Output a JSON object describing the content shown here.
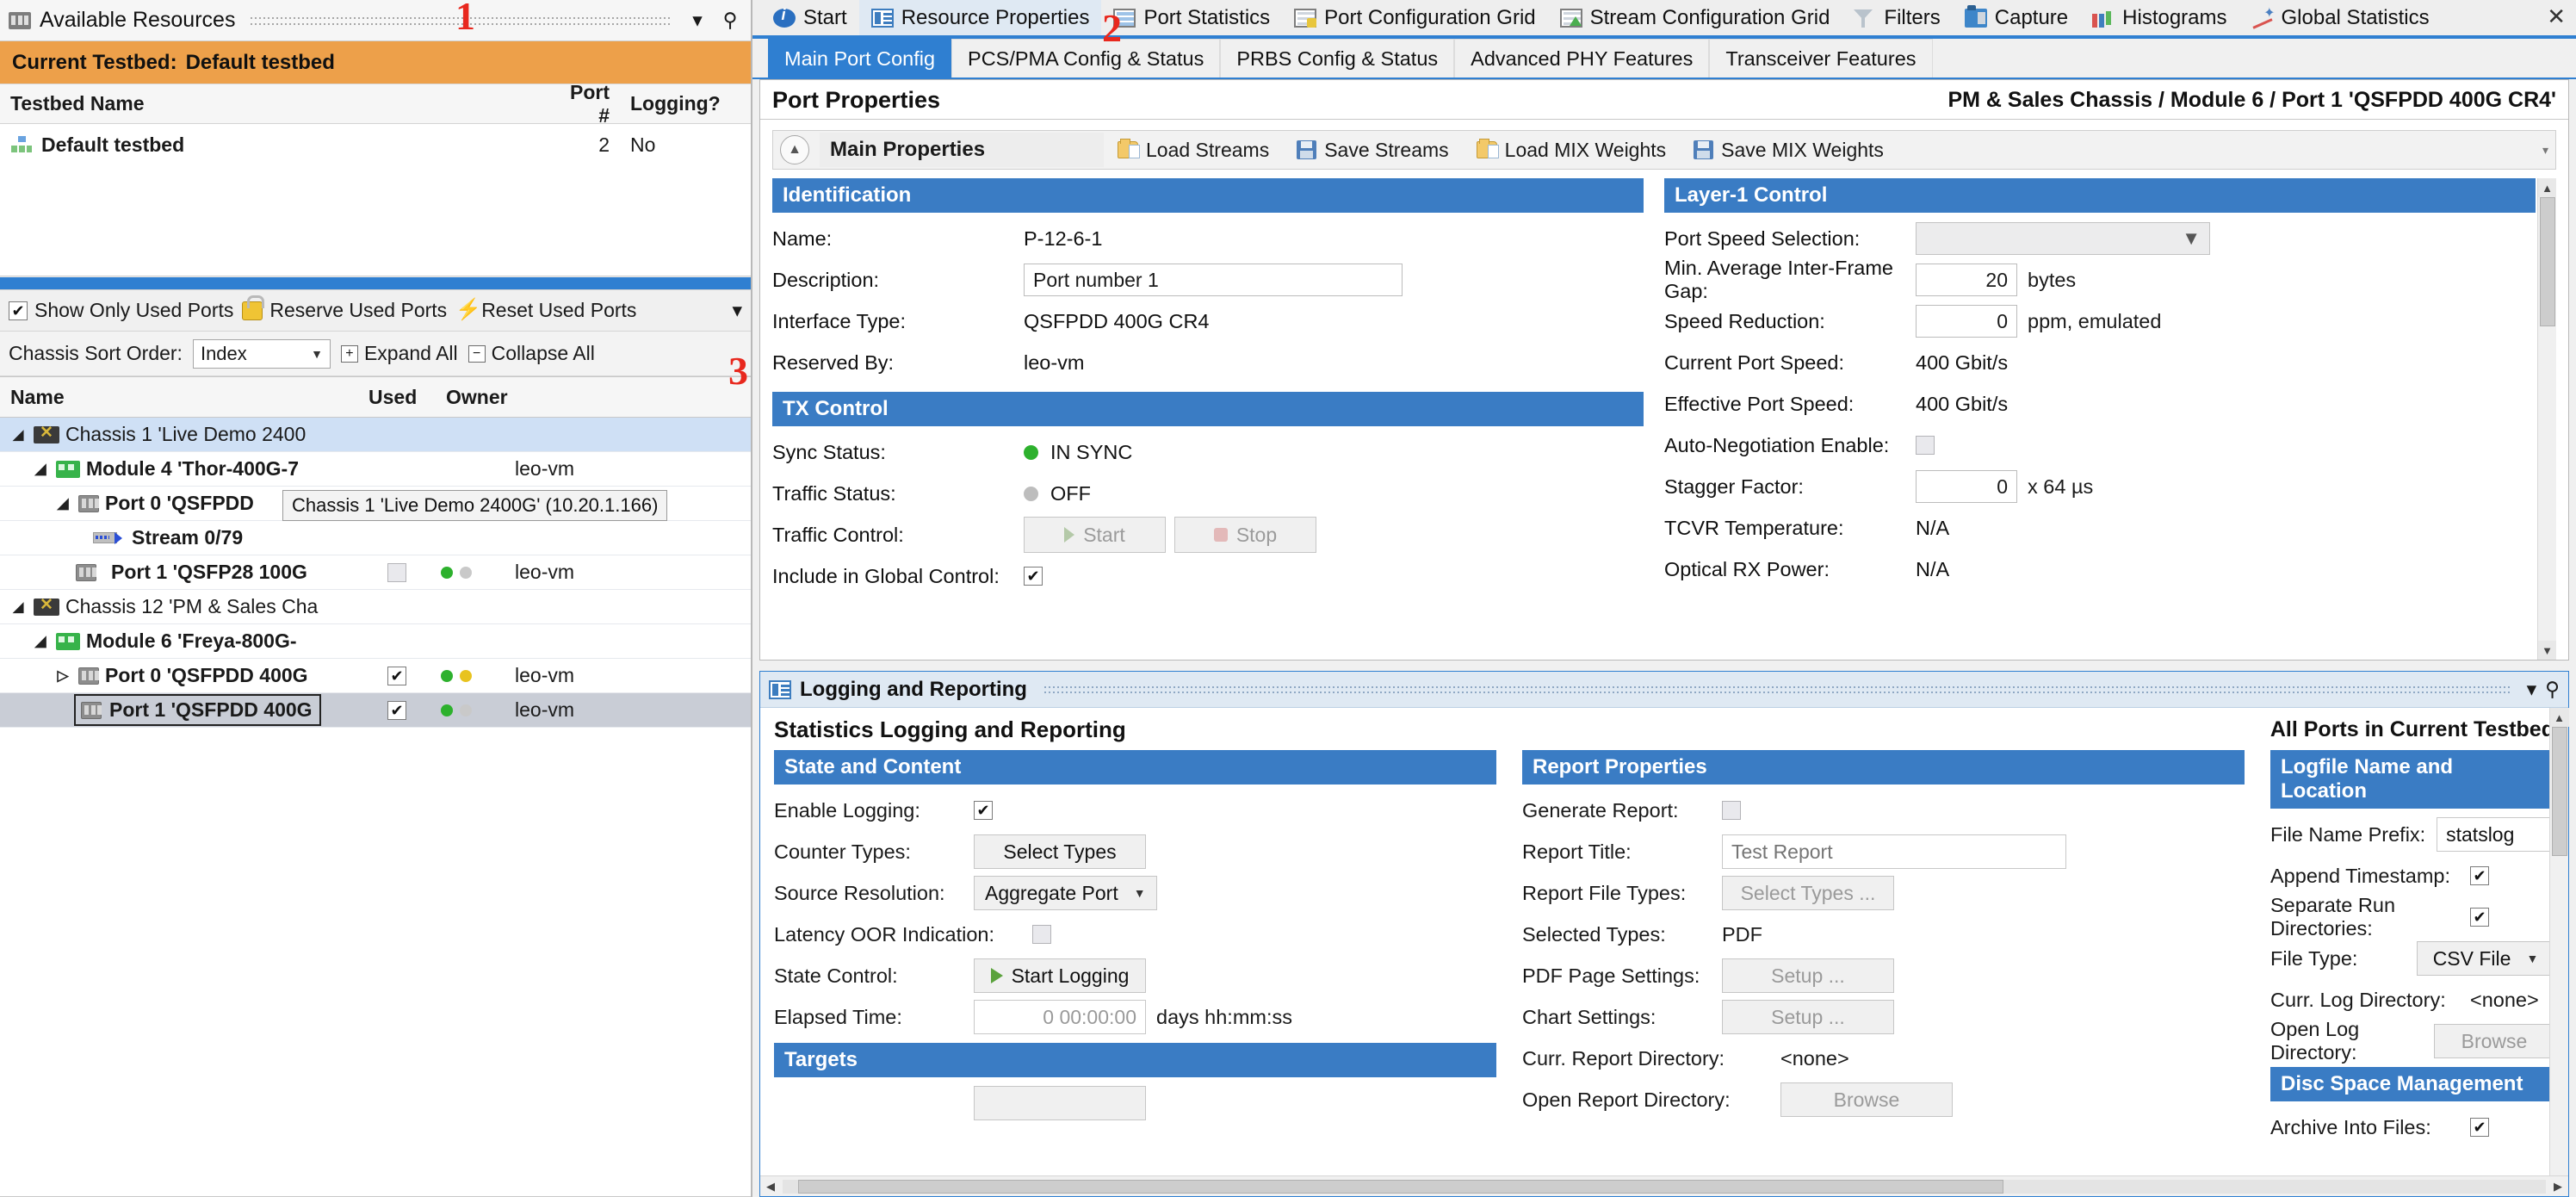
{
  "left_panel": {
    "title": "Available Resources",
    "title_icon": "resources-icon",
    "collapse_icon": "chevron-down-icon",
    "pin_icon": "pin-icon",
    "testbed_banner": {
      "label": "Current Testbed:",
      "value": "Default testbed"
    },
    "testbed_table": {
      "columns": [
        "Testbed Name",
        "Port #",
        "Logging?"
      ],
      "rows": [
        {
          "name": "Default testbed",
          "port_count": "2",
          "logging": "No"
        }
      ]
    },
    "toolbar": {
      "show_only_used_ports": {
        "label": "Show Only Used Ports",
        "checked": true
      },
      "reserve_used_ports": "Reserve Used Ports",
      "reset_used_ports": "Reset Used Ports",
      "overflow_icon": "chevron-down-icon"
    },
    "sort_row": {
      "label": "Chassis Sort Order:",
      "selected": "Index",
      "expand_all": "Expand All",
      "collapse_all": "Collapse All"
    },
    "tree": {
      "columns": [
        "Name",
        "Used",
        "Owner"
      ],
      "tooltip": "Chassis 1 'Live Demo 2400G' (10.20.1.166)",
      "rows": [
        {
          "indent": 0,
          "expander": "down",
          "icon": "chassis-icon",
          "label": "Chassis 1 'Live Demo 2400",
          "bold": false,
          "selected": "light",
          "used": "",
          "owner": "",
          "leds": []
        },
        {
          "indent": 1,
          "expander": "down",
          "icon": "module-icon",
          "label": "Module 4 'Thor-400G-7",
          "bold": true,
          "used": "",
          "owner": "leo-vm",
          "leds": []
        },
        {
          "indent": 2,
          "expander": "down",
          "icon": "port-icon",
          "label": "Port 0 'QSFPDD",
          "bold": true,
          "used": "",
          "owner": "",
          "leds": []
        },
        {
          "indent": 3,
          "expander": "none",
          "icon": "stream-icon",
          "label": "Stream 0/79",
          "bold": true,
          "used": "",
          "owner": "",
          "leds": []
        },
        {
          "indent": 3,
          "expander": "none",
          "icon": "port-icon",
          "label": "Port 1 'QSFP28 100G",
          "bold": true,
          "used": "unchecked",
          "owner": "leo-vm",
          "leds": [
            "green",
            "gray"
          ]
        },
        {
          "indent": 0,
          "expander": "down",
          "icon": "chassis-icon",
          "label": "Chassis 12 'PM & Sales Cha",
          "bold": false,
          "used": "",
          "owner": "",
          "leds": []
        },
        {
          "indent": 1,
          "expander": "down",
          "icon": "module-icon",
          "label": "Module 6 'Freya-800G-",
          "bold": true,
          "used": "",
          "owner": "",
          "leds": []
        },
        {
          "indent": 2,
          "expander": "right",
          "icon": "port-icon",
          "label": "Port 0 'QSFPDD 400G",
          "bold": true,
          "used": "checked",
          "owner": "leo-vm",
          "leds": [
            "green",
            "yellow"
          ]
        },
        {
          "indent": 3,
          "expander": "none",
          "icon": "port-icon",
          "label": "Port 1 'QSFPDD 400G",
          "bold": true,
          "selected": "gray",
          "used": "checked",
          "owner": "leo-vm",
          "leds": [
            "green",
            "gray"
          ]
        }
      ]
    }
  },
  "doc_tabs": [
    {
      "label": "Start",
      "icon": "info-icon",
      "active": false
    },
    {
      "label": "Resource Properties",
      "icon": "resource-properties-icon",
      "active": true
    },
    {
      "label": "Port Statistics",
      "icon": "port-statistics-icon",
      "active": false
    },
    {
      "label": "Port Configuration Grid",
      "icon": "port-configuration-grid-icon",
      "active": false
    },
    {
      "label": "Stream Configuration Grid",
      "icon": "stream-configuration-grid-icon",
      "active": false
    },
    {
      "label": "Filters",
      "icon": "filter-icon",
      "active": false
    },
    {
      "label": "Capture",
      "icon": "capture-icon",
      "active": false
    },
    {
      "label": "Histograms",
      "icon": "histogram-icon",
      "active": false
    },
    {
      "label": "Global Statistics",
      "icon": "global-statistics-icon",
      "active": false
    }
  ],
  "doc_tabs_right": {
    "close_icon": "close-icon",
    "list_icon": "tab-list-icon"
  },
  "inner_tabs": [
    {
      "label": "Main Port Config",
      "active": true
    },
    {
      "label": "PCS/PMA Config & Status",
      "active": false
    },
    {
      "label": "PRBS Config & Status",
      "active": false
    },
    {
      "label": "Advanced PHY Features",
      "active": false
    },
    {
      "label": "Transceiver Features",
      "active": false
    }
  ],
  "port_properties": {
    "title": "Port Properties",
    "breadcrumb": "PM & Sales Chassis / Module 6 / Port 1 'QSFPDD 400G CR4'",
    "group_title": "Main Properties",
    "collapse_icon": "chevron-up-icon",
    "toolbar_buttons": [
      {
        "label": "Load Streams",
        "icon": "folder-open-icon"
      },
      {
        "label": "Save Streams",
        "icon": "save-icon"
      },
      {
        "label": "Load MIX Weights",
        "icon": "folder-open-icon"
      },
      {
        "label": "Save MIX Weights",
        "icon": "save-icon"
      }
    ],
    "identification": {
      "header": "Identification",
      "rows": [
        {
          "label": "Name:",
          "value": "P-12-6-1",
          "type": "text"
        },
        {
          "label": "Description:",
          "value": "Port number 1",
          "type": "input"
        },
        {
          "label": "Interface Type:",
          "value": "QSFPDD 400G CR4",
          "type": "text"
        },
        {
          "label": "Reserved By:",
          "value": "leo-vm",
          "type": "text"
        }
      ]
    },
    "tx_control": {
      "header": "TX Control",
      "sync_status": {
        "label": "Sync Status:",
        "value": "IN SYNC",
        "led": "green"
      },
      "traffic_status": {
        "label": "Traffic Status:",
        "value": "OFF",
        "led": "gray"
      },
      "traffic_control": {
        "label": "Traffic Control:",
        "start": "Start",
        "stop": "Stop"
      },
      "include_global": {
        "label": "Include in Global Control:",
        "checked": true
      }
    },
    "layer1_control": {
      "header": "Layer-1 Control",
      "rows": [
        {
          "label": "Port Speed Selection:",
          "value": "",
          "type": "combo"
        },
        {
          "label": "Min. Average Inter-Frame Gap:",
          "value": "20",
          "unit": "bytes",
          "type": "num"
        },
        {
          "label": "Speed Reduction:",
          "value": "0",
          "unit": "ppm, emulated",
          "type": "num"
        },
        {
          "label": "Current Port Speed:",
          "value": "400 Gbit/s",
          "type": "text"
        },
        {
          "label": "Effective Port Speed:",
          "value": "400 Gbit/s",
          "type": "text"
        },
        {
          "label": "Auto-Negotiation Enable:",
          "value": "",
          "type": "checkbox",
          "checked": false
        },
        {
          "label": "Stagger Factor:",
          "value": "0",
          "unit": "x 64 µs",
          "type": "num"
        },
        {
          "label": "TCVR Temperature:",
          "value": "N/A",
          "type": "text"
        },
        {
          "label": "Optical RX Power:",
          "value": "N/A",
          "type": "text"
        }
      ]
    }
  },
  "logging_panel": {
    "titlebar": "Logging and Reporting",
    "titlebar_icon": "logging-icon",
    "collapse_icon": "chevron-down-icon",
    "pin_icon": "pin-icon",
    "heading": "Statistics Logging and Reporting",
    "scope": "All Ports in Current Testbed",
    "state_and_content": {
      "header": "State and Content",
      "enable_logging": {
        "label": "Enable Logging:",
        "checked": true
      },
      "counter_types": {
        "label": "Counter Types:",
        "button": "Select Types"
      },
      "source_resolution": {
        "label": "Source Resolution:",
        "value": "Aggregate Port"
      },
      "latency_oor": {
        "label": "Latency OOR Indication:",
        "checked": false
      },
      "state_control": {
        "label": "State Control:",
        "button": "Start Logging",
        "icon": "play-icon"
      },
      "elapsed_time": {
        "label": "Elapsed Time:",
        "value": "0 00:00:00",
        "unit": "days hh:mm:ss"
      },
      "targets_header": "Targets"
    },
    "report_properties": {
      "header": "Report Properties",
      "generate_report": {
        "label": "Generate Report:",
        "checked": false
      },
      "report_title": {
        "label": "Report Title:",
        "placeholder": "Test Report"
      },
      "report_file_types": {
        "label": "Report File Types:",
        "button": "Select Types ..."
      },
      "selected_types": {
        "label": "Selected Types:",
        "value": "PDF"
      },
      "pdf_page_settings": {
        "label": "PDF Page Settings:",
        "button": "Setup ..."
      },
      "chart_settings": {
        "label": "Chart Settings:",
        "button": "Setup ..."
      },
      "curr_report_directory": {
        "label": "Curr. Report Directory:",
        "value": "<none>"
      },
      "open_report_directory": {
        "label": "Open Report Directory:",
        "button": "Browse"
      }
    },
    "logfile_name_location": {
      "header": "Logfile Name and Location",
      "file_name_prefix": {
        "label": "File Name Prefix:",
        "value": "statslog"
      },
      "append_timestamp": {
        "label": "Append Timestamp:",
        "checked": true
      },
      "separate_run_directories": {
        "label": "Separate Run Directories:",
        "checked": true
      },
      "file_type": {
        "label": "File Type:",
        "value": "CSV File"
      },
      "curr_log_directory": {
        "label": "Curr. Log Directory:",
        "value": "<none>"
      },
      "open_log_directory": {
        "label": "Open Log Directory:",
        "button": "Browse"
      },
      "disc_space_header": "Disc Space Management",
      "archive_into_files": {
        "label": "Archive Into Files:",
        "checked": true
      }
    }
  },
  "annotations": {
    "one": "1",
    "two": "2",
    "three": "3"
  },
  "colors": {
    "accent_blue": "#2f7fd1",
    "section_header_blue": "#3a7cc4",
    "testbed_orange": "#eda04a",
    "annotation_red": "#e8281e",
    "led_green": "#2db12d",
    "led_yellow": "#e8c31f"
  }
}
